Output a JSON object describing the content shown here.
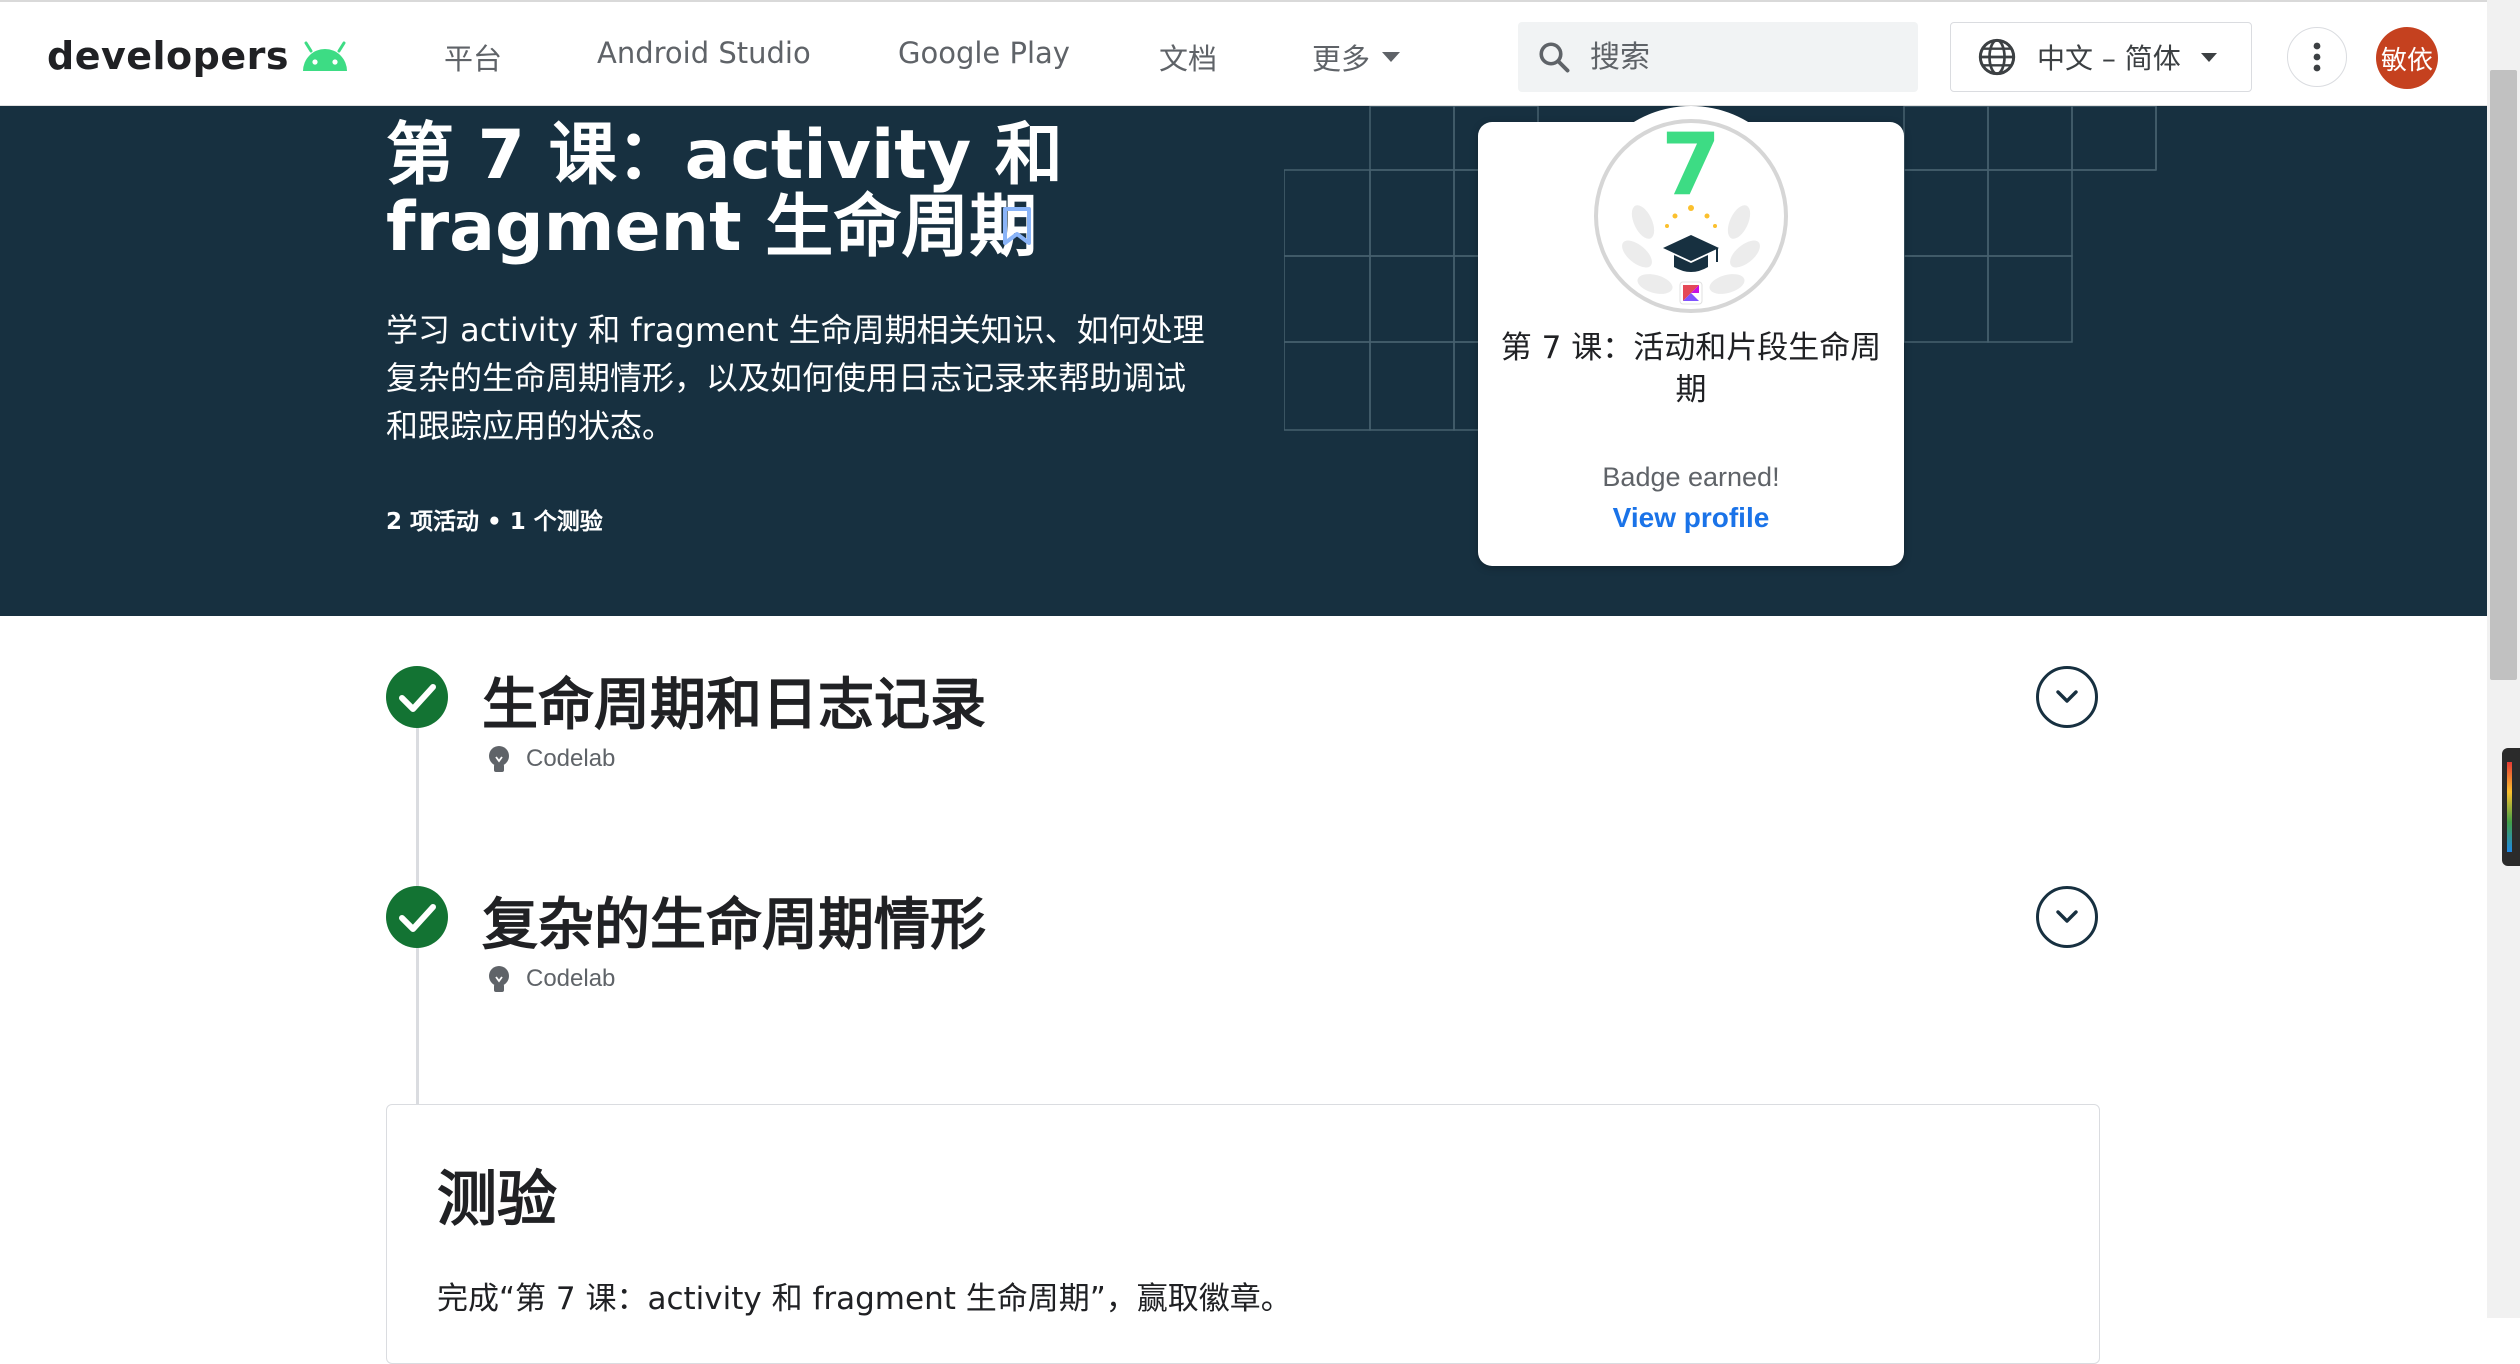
{
  "header": {
    "logo_text": "developers",
    "nav": [
      "平台",
      "Android Studio",
      "Google Play",
      "文档",
      "更多"
    ],
    "search_placeholder": "搜索",
    "language": "中文 – 简体",
    "avatar_text": "敏依"
  },
  "hero": {
    "title_line1": "第 7 课：activity 和",
    "title_line2": "fragment 生命周期",
    "description": "学习 activity 和 fragment 生命周期相关知识、如何处理复杂的生命周期情形，以及如何使用日志记录来帮助调试和跟踪应用的状态。",
    "meta": "2 项活动 • 1 个测验"
  },
  "badge": {
    "number": "7",
    "title": "第 7 课：活动和片段生命周期",
    "earned": "Badge earned!",
    "link": "View profile"
  },
  "lessons": [
    {
      "title": "生命周期和日志记录",
      "type": "Codelab",
      "completed": true
    },
    {
      "title": "复杂的生命周期情形",
      "type": "Codelab",
      "completed": true
    }
  ],
  "quiz": {
    "title": "测验",
    "description": "完成“第 7 课：activity 和 fragment 生命周期”，赢取徽章。"
  },
  "colors": {
    "hero_bg": "#173040",
    "check_green": "#137333",
    "link_blue": "#1a73e8",
    "avatar_bg": "#c5411f",
    "android_green": "#3ddc84"
  }
}
